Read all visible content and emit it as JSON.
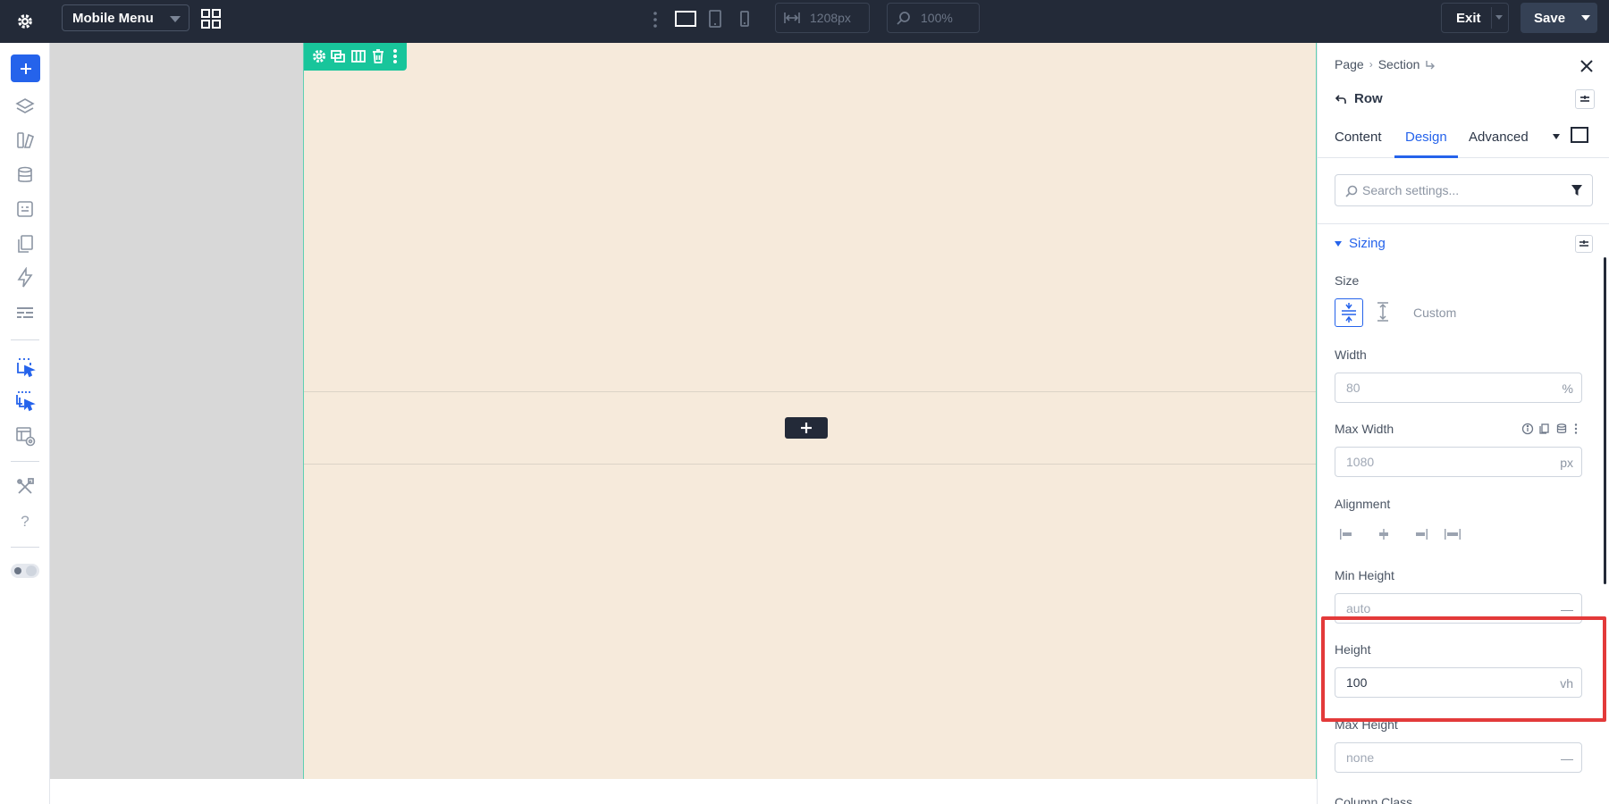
{
  "topbar": {
    "page_select": "Mobile Menu",
    "width_value": "1208px",
    "zoom_value": "100%",
    "exit_label": "Exit",
    "save_label": "Save"
  },
  "sidebar": {
    "help_label": "?"
  },
  "panel": {
    "breadcrumb": [
      "Page",
      "Section"
    ],
    "element_title": "Row",
    "tabs": [
      {
        "label": "Content",
        "active": false
      },
      {
        "label": "Design",
        "active": true
      },
      {
        "label": "Advanced",
        "active": false
      }
    ],
    "search_placeholder": "Search settings...",
    "group": {
      "title": "Sizing",
      "size_label": "Size",
      "size_custom_label": "Custom",
      "width": {
        "label": "Width",
        "value": "80",
        "unit": "%"
      },
      "max_width": {
        "label": "Max Width",
        "value": "1080",
        "unit": "px"
      },
      "alignment_label": "Alignment",
      "min_height": {
        "label": "Min Height",
        "value": "auto",
        "unit": "—"
      },
      "height": {
        "label": "Height",
        "value": "100",
        "unit": "vh"
      },
      "max_height": {
        "label": "Max Height",
        "value": "none",
        "unit": "—"
      },
      "column_class_label": "Column Class"
    }
  },
  "colors": {
    "topbar_bg": "#232a38",
    "accent_blue": "#2563eb",
    "row_toolbar": "#18c59b",
    "section_bg": "#f6eadb",
    "highlight": "#e33a3a"
  },
  "icons": [
    "gear-icon",
    "grid-icon",
    "kebab-icon",
    "desktop-icon",
    "tablet-icon",
    "phone-icon",
    "width-icon",
    "zoom-icon",
    "plus-icon",
    "layers-icon",
    "library-icon",
    "database-icon",
    "form-icon",
    "pages-icon",
    "lightning-icon",
    "layout-icon",
    "select-icon",
    "multi-select-icon",
    "template-icon",
    "tools-icon",
    "help-icon",
    "toggle-icon",
    "close-icon",
    "undo-icon",
    "search-icon",
    "filter-icon"
  ]
}
